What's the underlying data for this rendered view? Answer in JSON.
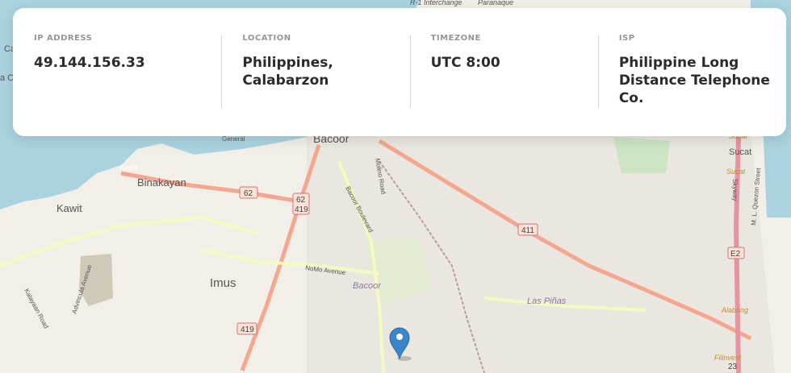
{
  "info": {
    "ip_label": "IP ADDRESS",
    "ip_value": "49.144.156.33",
    "location_label": "LOCATION",
    "location_value": "Philippines, Calabarzon",
    "timezone_label": "TIMEZONE",
    "timezone_value": "UTC 8:00",
    "isp_label": "ISP",
    "isp_value": "Philippine Long Distance Telephone Co."
  },
  "map": {
    "places": {
      "bacoor": "Bacoor",
      "binakayan": "Binakayan",
      "kawit": "Kawit",
      "kawit_small": "Kawit",
      "imus": "Imus",
      "bacoor_district": "Bacoor",
      "las_pinas": "Las Piñas",
      "sucat_1": "Sucat",
      "sucat_2": "Sucat",
      "sucat_3": "Sucat",
      "alabang": "Alabang",
      "filinvest": "Filinvest",
      "interchange": "R-1 Interchange",
      "paranaque": "Paranaque",
      "cavite_partial": "Ca",
      "cavite_partial_2": "a Cr",
      "general": "General"
    },
    "roads": {
      "molino": "Molino Road",
      "bacoor_blvd": "Bacoor Boulevard",
      "nomo": "NoMo Avenue",
      "aguinaldo": "Advincula Avenue",
      "kalayaan": "Kalayaan Road",
      "skyway": "Skyway",
      "mlq": "M. L. Quezon Street"
    },
    "shields": {
      "s62": "62",
      "s62b": "62",
      "s419": "419",
      "s411": "411",
      "s419b": "419",
      "e2": "E2",
      "s23": "23"
    },
    "colors": {
      "water": "#aad3df",
      "land": "#f2efe9",
      "primary_road": "#f4a68f",
      "secondary_road": "#f7fabf",
      "motorway": "#e892a2",
      "marker": "#3b86c8"
    }
  }
}
